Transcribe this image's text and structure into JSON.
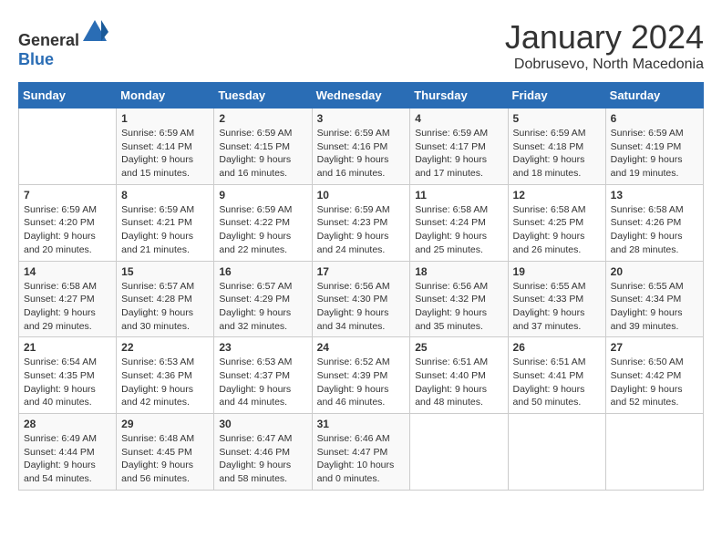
{
  "logo": {
    "general": "General",
    "blue": "Blue"
  },
  "title": "January 2024",
  "subtitle": "Dobrusevo, North Macedonia",
  "days_of_week": [
    "Sunday",
    "Monday",
    "Tuesday",
    "Wednesday",
    "Thursday",
    "Friday",
    "Saturday"
  ],
  "weeks": [
    [
      {
        "day": "",
        "sunrise": "",
        "sunset": "",
        "daylight": ""
      },
      {
        "day": "1",
        "sunrise": "Sunrise: 6:59 AM",
        "sunset": "Sunset: 4:14 PM",
        "daylight": "Daylight: 9 hours and 15 minutes."
      },
      {
        "day": "2",
        "sunrise": "Sunrise: 6:59 AM",
        "sunset": "Sunset: 4:15 PM",
        "daylight": "Daylight: 9 hours and 16 minutes."
      },
      {
        "day": "3",
        "sunrise": "Sunrise: 6:59 AM",
        "sunset": "Sunset: 4:16 PM",
        "daylight": "Daylight: 9 hours and 16 minutes."
      },
      {
        "day": "4",
        "sunrise": "Sunrise: 6:59 AM",
        "sunset": "Sunset: 4:17 PM",
        "daylight": "Daylight: 9 hours and 17 minutes."
      },
      {
        "day": "5",
        "sunrise": "Sunrise: 6:59 AM",
        "sunset": "Sunset: 4:18 PM",
        "daylight": "Daylight: 9 hours and 18 minutes."
      },
      {
        "day": "6",
        "sunrise": "Sunrise: 6:59 AM",
        "sunset": "Sunset: 4:19 PM",
        "daylight": "Daylight: 9 hours and 19 minutes."
      }
    ],
    [
      {
        "day": "7",
        "sunrise": "Sunrise: 6:59 AM",
        "sunset": "Sunset: 4:20 PM",
        "daylight": "Daylight: 9 hours and 20 minutes."
      },
      {
        "day": "8",
        "sunrise": "Sunrise: 6:59 AM",
        "sunset": "Sunset: 4:21 PM",
        "daylight": "Daylight: 9 hours and 21 minutes."
      },
      {
        "day": "9",
        "sunrise": "Sunrise: 6:59 AM",
        "sunset": "Sunset: 4:22 PM",
        "daylight": "Daylight: 9 hours and 22 minutes."
      },
      {
        "day": "10",
        "sunrise": "Sunrise: 6:59 AM",
        "sunset": "Sunset: 4:23 PM",
        "daylight": "Daylight: 9 hours and 24 minutes."
      },
      {
        "day": "11",
        "sunrise": "Sunrise: 6:58 AM",
        "sunset": "Sunset: 4:24 PM",
        "daylight": "Daylight: 9 hours and 25 minutes."
      },
      {
        "day": "12",
        "sunrise": "Sunrise: 6:58 AM",
        "sunset": "Sunset: 4:25 PM",
        "daylight": "Daylight: 9 hours and 26 minutes."
      },
      {
        "day": "13",
        "sunrise": "Sunrise: 6:58 AM",
        "sunset": "Sunset: 4:26 PM",
        "daylight": "Daylight: 9 hours and 28 minutes."
      }
    ],
    [
      {
        "day": "14",
        "sunrise": "Sunrise: 6:58 AM",
        "sunset": "Sunset: 4:27 PM",
        "daylight": "Daylight: 9 hours and 29 minutes."
      },
      {
        "day": "15",
        "sunrise": "Sunrise: 6:57 AM",
        "sunset": "Sunset: 4:28 PM",
        "daylight": "Daylight: 9 hours and 30 minutes."
      },
      {
        "day": "16",
        "sunrise": "Sunrise: 6:57 AM",
        "sunset": "Sunset: 4:29 PM",
        "daylight": "Daylight: 9 hours and 32 minutes."
      },
      {
        "day": "17",
        "sunrise": "Sunrise: 6:56 AM",
        "sunset": "Sunset: 4:30 PM",
        "daylight": "Daylight: 9 hours and 34 minutes."
      },
      {
        "day": "18",
        "sunrise": "Sunrise: 6:56 AM",
        "sunset": "Sunset: 4:32 PM",
        "daylight": "Daylight: 9 hours and 35 minutes."
      },
      {
        "day": "19",
        "sunrise": "Sunrise: 6:55 AM",
        "sunset": "Sunset: 4:33 PM",
        "daylight": "Daylight: 9 hours and 37 minutes."
      },
      {
        "day": "20",
        "sunrise": "Sunrise: 6:55 AM",
        "sunset": "Sunset: 4:34 PM",
        "daylight": "Daylight: 9 hours and 39 minutes."
      }
    ],
    [
      {
        "day": "21",
        "sunrise": "Sunrise: 6:54 AM",
        "sunset": "Sunset: 4:35 PM",
        "daylight": "Daylight: 9 hours and 40 minutes."
      },
      {
        "day": "22",
        "sunrise": "Sunrise: 6:53 AM",
        "sunset": "Sunset: 4:36 PM",
        "daylight": "Daylight: 9 hours and 42 minutes."
      },
      {
        "day": "23",
        "sunrise": "Sunrise: 6:53 AM",
        "sunset": "Sunset: 4:37 PM",
        "daylight": "Daylight: 9 hours and 44 minutes."
      },
      {
        "day": "24",
        "sunrise": "Sunrise: 6:52 AM",
        "sunset": "Sunset: 4:39 PM",
        "daylight": "Daylight: 9 hours and 46 minutes."
      },
      {
        "day": "25",
        "sunrise": "Sunrise: 6:51 AM",
        "sunset": "Sunset: 4:40 PM",
        "daylight": "Daylight: 9 hours and 48 minutes."
      },
      {
        "day": "26",
        "sunrise": "Sunrise: 6:51 AM",
        "sunset": "Sunset: 4:41 PM",
        "daylight": "Daylight: 9 hours and 50 minutes."
      },
      {
        "day": "27",
        "sunrise": "Sunrise: 6:50 AM",
        "sunset": "Sunset: 4:42 PM",
        "daylight": "Daylight: 9 hours and 52 minutes."
      }
    ],
    [
      {
        "day": "28",
        "sunrise": "Sunrise: 6:49 AM",
        "sunset": "Sunset: 4:44 PM",
        "daylight": "Daylight: 9 hours and 54 minutes."
      },
      {
        "day": "29",
        "sunrise": "Sunrise: 6:48 AM",
        "sunset": "Sunset: 4:45 PM",
        "daylight": "Daylight: 9 hours and 56 minutes."
      },
      {
        "day": "30",
        "sunrise": "Sunrise: 6:47 AM",
        "sunset": "Sunset: 4:46 PM",
        "daylight": "Daylight: 9 hours and 58 minutes."
      },
      {
        "day": "31",
        "sunrise": "Sunrise: 6:46 AM",
        "sunset": "Sunset: 4:47 PM",
        "daylight": "Daylight: 10 hours and 0 minutes."
      },
      {
        "day": "",
        "sunrise": "",
        "sunset": "",
        "daylight": ""
      },
      {
        "day": "",
        "sunrise": "",
        "sunset": "",
        "daylight": ""
      },
      {
        "day": "",
        "sunrise": "",
        "sunset": "",
        "daylight": ""
      }
    ]
  ]
}
